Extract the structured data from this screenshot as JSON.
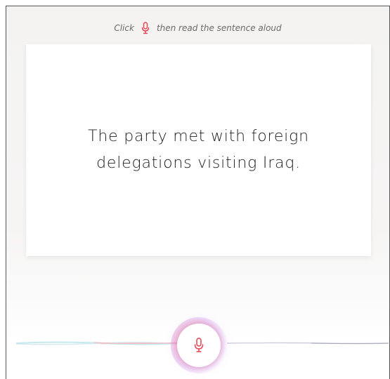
{
  "instruction": {
    "before": "Click",
    "after": "then read the sentence aloud",
    "icon": "microphone-icon"
  },
  "prompt": {
    "sentence": "The party met with foreign delegations visiting Iraq."
  },
  "record": {
    "icon": "microphone-icon"
  },
  "colors": {
    "accent": "#e5414f",
    "text": "#222222",
    "muted": "#6a6a6a"
  }
}
